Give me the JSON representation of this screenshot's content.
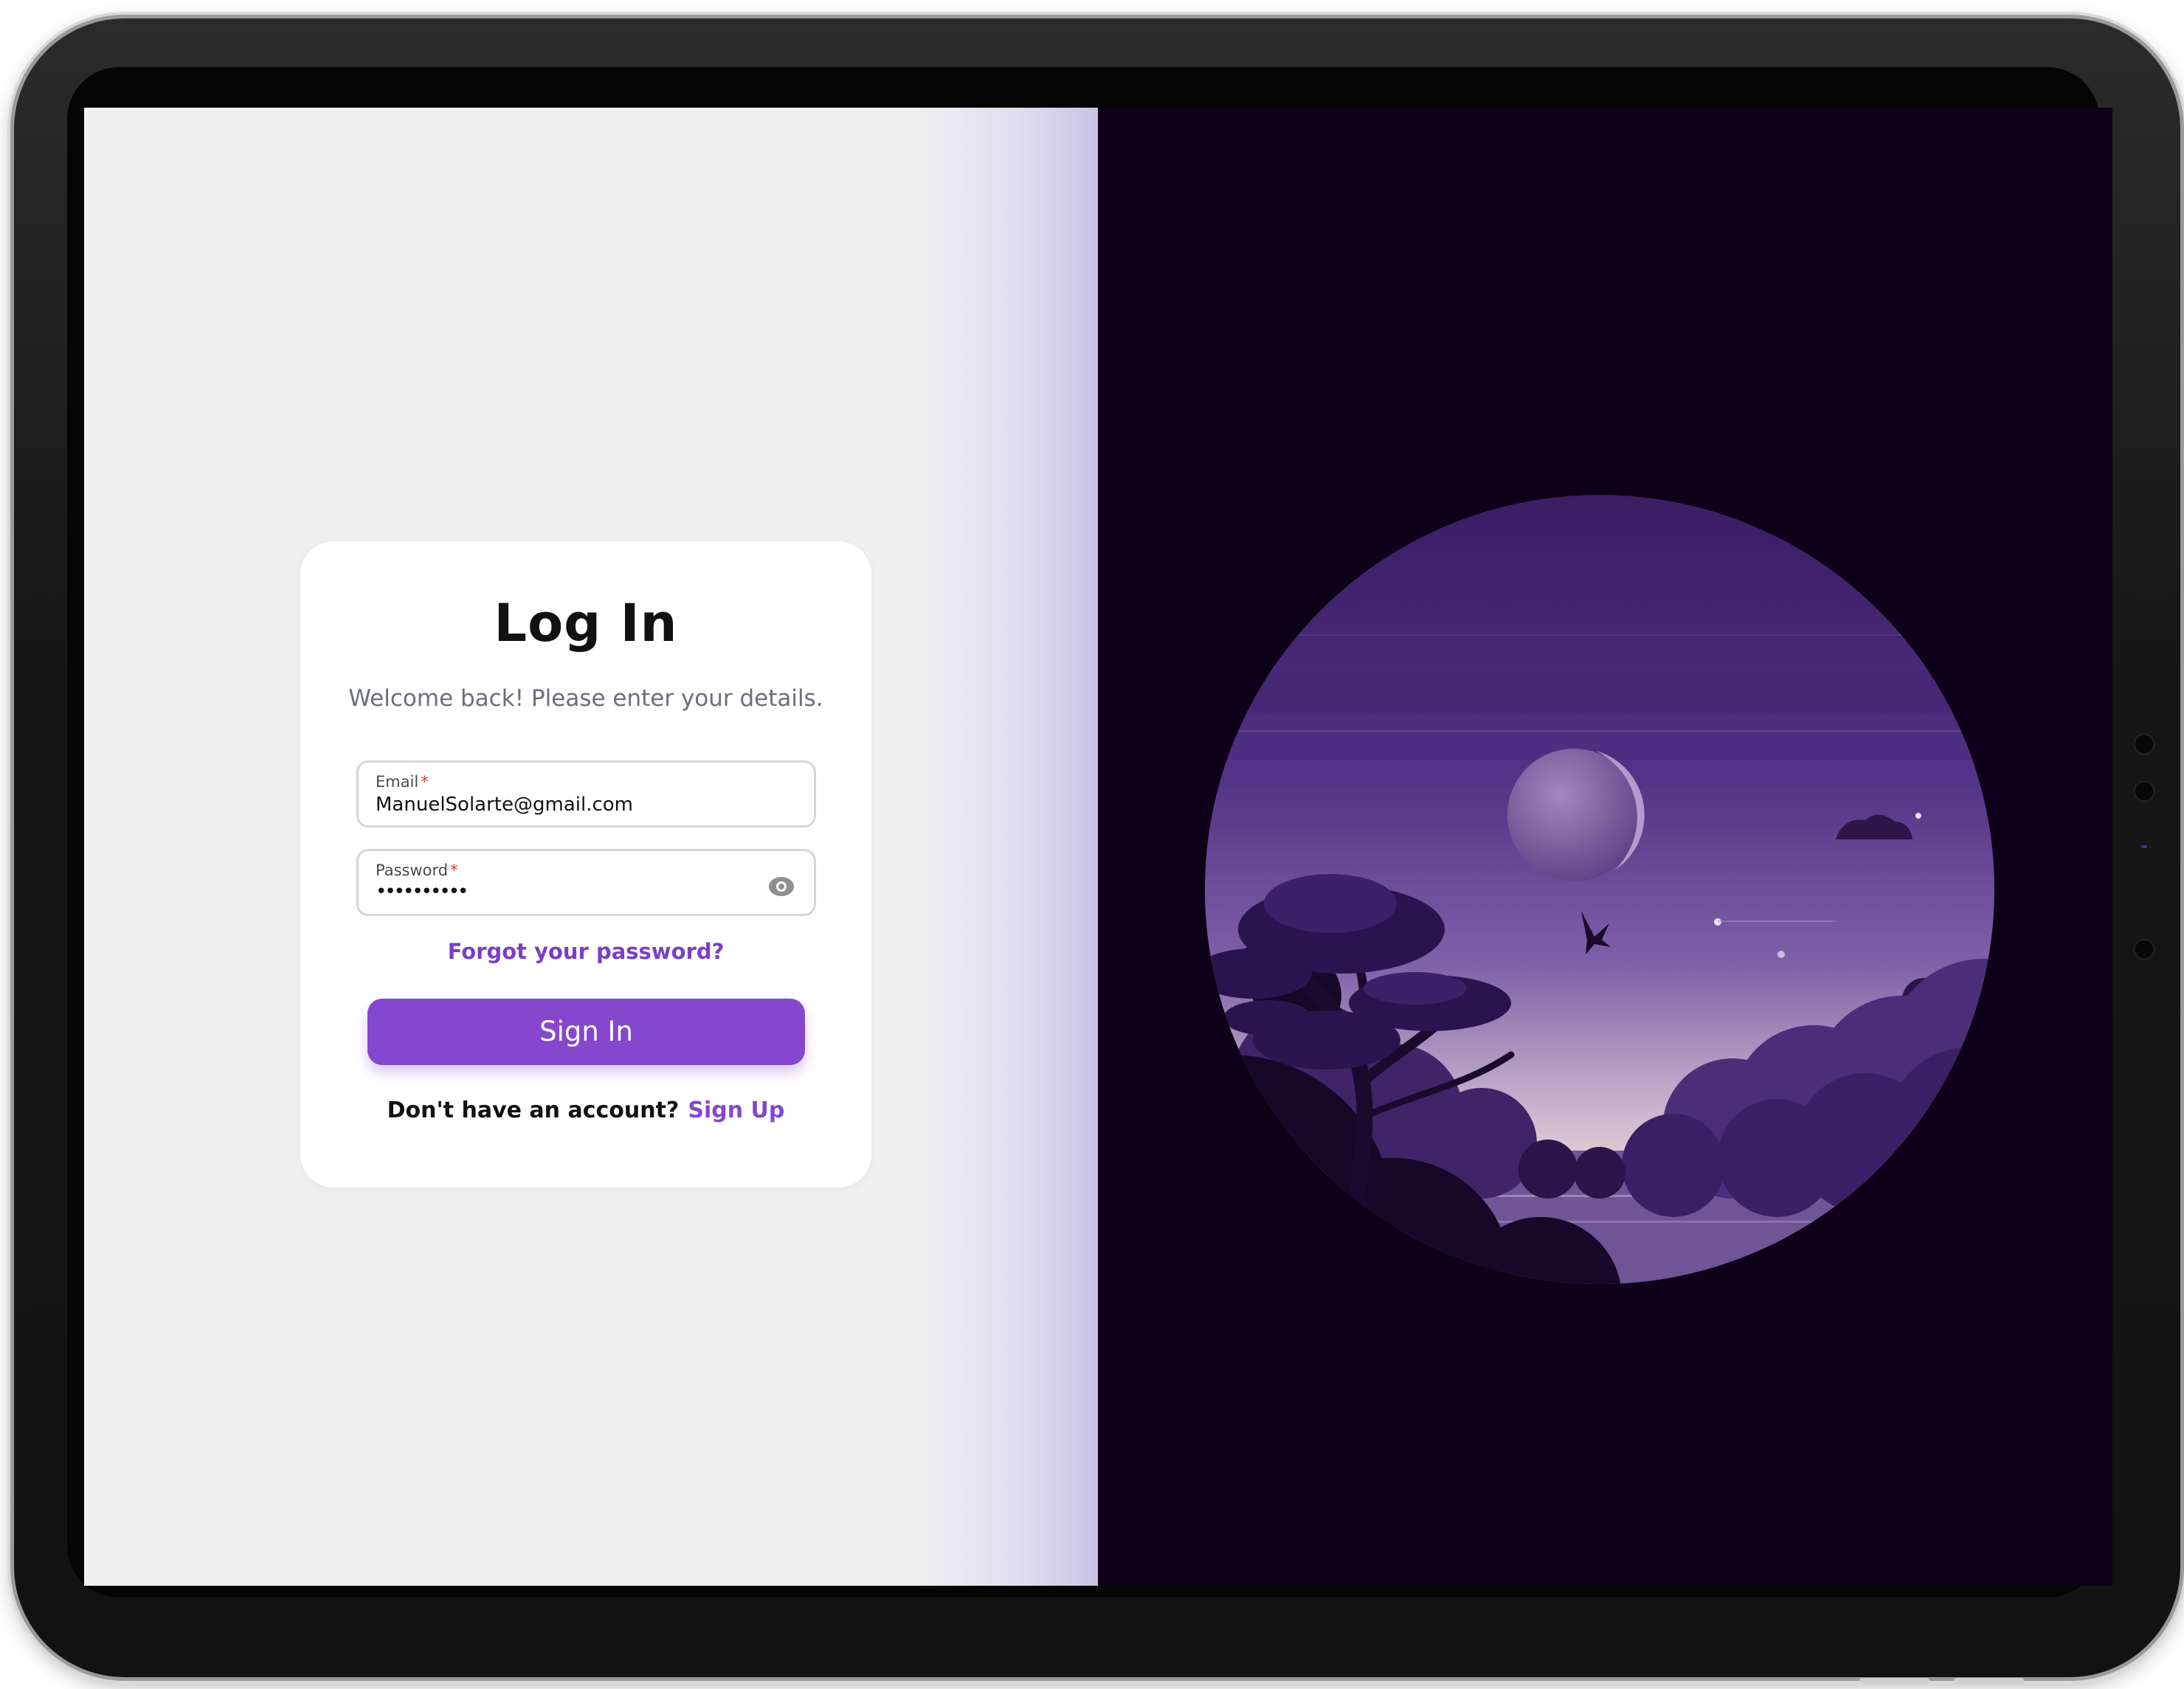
{
  "login": {
    "title": "Log In",
    "subtitle": "Welcome back! Please enter your details.",
    "email": {
      "label": "Email",
      "required_mark": "*",
      "value": "ManuelSolarte@gmail.com"
    },
    "password": {
      "label": "Password",
      "required_mark": "*",
      "masked_value": "••••••••••",
      "toggle_icon": "eye-icon"
    },
    "forgot_password": "Forgot your password?",
    "sign_in_button": "Sign In",
    "no_account_text": "Don't have an account?",
    "sign_up_link": "Sign Up"
  },
  "colors": {
    "accent": "#8447cd",
    "link": "#7a3fc4",
    "left_background": "#f0f0f1",
    "right_background": "#0e0018",
    "required": "#d23b3b"
  },
  "illustration": {
    "description_icon": "night-landscape-illustration"
  }
}
